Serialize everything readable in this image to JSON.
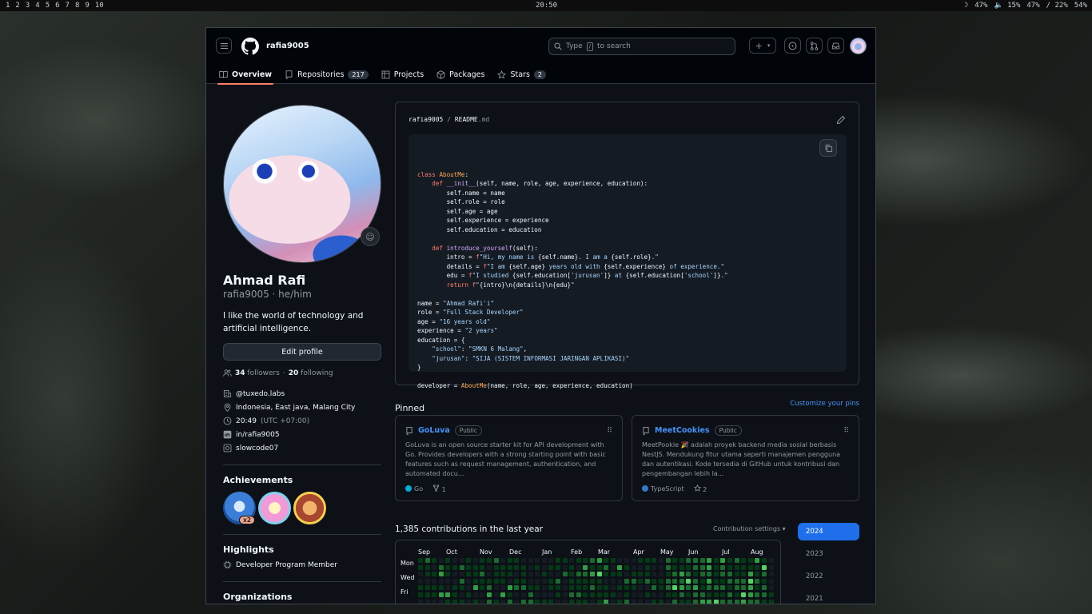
{
  "topbar": {
    "workspaces": [
      "1",
      "2",
      "3",
      "4",
      "5",
      "6",
      "7",
      "8",
      "9",
      "10"
    ],
    "clock": "20:50",
    "status": [
      "47%",
      "15%",
      "47%",
      "/ 22%",
      "54%"
    ]
  },
  "header": {
    "username": "rafia9005",
    "search_placeholder_prefix": "Type",
    "search_key": "/",
    "search_placeholder_suffix": "to search",
    "plus": "+"
  },
  "tabs": [
    {
      "label": "Overview",
      "count": ""
    },
    {
      "label": "Repositories",
      "count": "217"
    },
    {
      "label": "Projects",
      "count": ""
    },
    {
      "label": "Packages",
      "count": ""
    },
    {
      "label": "Stars",
      "count": "2"
    }
  ],
  "profile": {
    "name": "Ahmad Rafi",
    "login": "rafia9005 · he/him",
    "bio": "I like the world of technology and artificial intelligence.",
    "edit_label": "Edit profile",
    "followers": "34",
    "followers_label": "followers",
    "following": "20",
    "following_label": "following",
    "company": "@tuxedo.labs",
    "location": "Indonesia, East java, Malang City",
    "time": "20:49",
    "timezone": "(UTC +07:00)",
    "linkedin": "in/rafia9005",
    "social": "slowcode07"
  },
  "achievements": {
    "title": "Achievements",
    "badges": [
      "pull-shark-badge",
      "yolo-badge",
      "quickdraw-badge"
    ],
    "multiplier": "x2"
  },
  "highlights": {
    "title": "Highlights",
    "item": "Developer Program Member"
  },
  "organizations": {
    "title": "Organizations"
  },
  "readme": {
    "owner": "rafia9005",
    "sep": "/",
    "file": "README",
    "ext": ".md",
    "code": [
      [
        [
          "kw",
          "class "
        ],
        [
          "cls",
          "AboutMe"
        ],
        [
          "",
          ":"
        ]
      ],
      [
        [
          "",
          "    "
        ],
        [
          "kw",
          "def "
        ],
        [
          "fn",
          "__init__"
        ],
        [
          "",
          "(self, name, role, age, experience, education):"
        ]
      ],
      [
        [
          "",
          "        self.name = name"
        ]
      ],
      [
        [
          "",
          "        self.role = role"
        ]
      ],
      [
        [
          "",
          "        self.age = age"
        ]
      ],
      [
        [
          "",
          "        self.experience = experience"
        ]
      ],
      [
        [
          "",
          "        self.education = education"
        ]
      ],
      [
        [
          "",
          ""
        ]
      ],
      [
        [
          "",
          "    "
        ],
        [
          "kw",
          "def "
        ],
        [
          "fn",
          "introduce_yourself"
        ],
        [
          "",
          "(self):"
        ]
      ],
      [
        [
          "",
          "        intro = "
        ],
        [
          "kw",
          "f"
        ],
        [
          "str",
          "\"Hi, my name is "
        ],
        [
          "",
          "{self.name}"
        ],
        [
          "str",
          ". I am a "
        ],
        [
          "",
          "{self.role}"
        ],
        [
          "str",
          ".\""
        ]
      ],
      [
        [
          "",
          "        details = "
        ],
        [
          "kw",
          "f"
        ],
        [
          "str",
          "\"I am "
        ],
        [
          "",
          "{self.age}"
        ],
        [
          "str",
          " years old with "
        ],
        [
          "",
          "{self.experience}"
        ],
        [
          "str",
          " of experience.\""
        ]
      ],
      [
        [
          "",
          "        edu = "
        ],
        [
          "kw",
          "f"
        ],
        [
          "str",
          "\"I studied "
        ],
        [
          "",
          "{self.education["
        ],
        [
          "str",
          "'jurusan'"
        ],
        [
          "",
          "]}"
        ],
        [
          "str",
          " at "
        ],
        [
          "",
          "{self.education["
        ],
        [
          "str",
          "'school'"
        ],
        [
          "",
          "]}"
        ],
        [
          "str",
          ".\""
        ]
      ],
      [
        [
          "",
          "        "
        ],
        [
          "kw",
          "return "
        ],
        [
          "kw",
          "f"
        ],
        [
          "str",
          "\""
        ],
        [
          "",
          "{intro}\\n{details}\\n{edu}"
        ],
        [
          "str",
          "\""
        ]
      ],
      [
        [
          "",
          ""
        ]
      ],
      [
        [
          "",
          "name = "
        ],
        [
          "str",
          "\"Ahmad Rafi'i\""
        ]
      ],
      [
        [
          "",
          "role = "
        ],
        [
          "str",
          "\"Full Stack Developer\""
        ]
      ],
      [
        [
          "",
          "age = "
        ],
        [
          "str",
          "\"16 years old\""
        ]
      ],
      [
        [
          "",
          "experience = "
        ],
        [
          "str",
          "\"2 years\""
        ]
      ],
      [
        [
          "",
          "education = {"
        ]
      ],
      [
        [
          "",
          "    "
        ],
        [
          "str",
          "\"school\""
        ],
        [
          "",
          ": "
        ],
        [
          "str",
          "\"SMKN 6 Malang\""
        ],
        [
          "",
          ","
        ]
      ],
      [
        [
          "",
          "    "
        ],
        [
          "str",
          "\"jurusan\""
        ],
        [
          "",
          ": "
        ],
        [
          "str",
          "\"SIJA (SISTEM INFORMASI JARINGAN APLIKASI)\""
        ]
      ],
      [
        [
          "",
          "}"
        ]
      ],
      [
        [
          "",
          ""
        ]
      ],
      [
        [
          "",
          "developer = "
        ],
        [
          "cls",
          "AboutMe"
        ],
        [
          "",
          "(name, role, age, experience, education)"
        ]
      ]
    ]
  },
  "pinned": {
    "title": "Pinned",
    "customize": "Customize your pins",
    "repos": [
      {
        "name": "GoLuva",
        "visibility": "Public",
        "description": "GoLuva is an open source starter kit for API development with Go. Provides developers with a strong starting point with basic features such as request management, authentication, and automated docu...",
        "language": "Go",
        "language_color": "#00add8",
        "stat_icon": "fork-icon",
        "stat": "1"
      },
      {
        "name": "MeetCookies",
        "visibility": "Public",
        "description": "MeetPookie 🎉 adalah proyek backend media sosial berbasis NestJS. Mendukung fitur utama seperti manajemen pengguna dan autentikasi. Kode tersedia di GitHub untuk kontribusi dan pengembangan lebih la...",
        "language": "TypeScript",
        "language_color": "#3178c6",
        "stat_icon": "star-icon",
        "stat": "2"
      }
    ]
  },
  "contributions": {
    "title": "1,385 contributions in the last year",
    "settings": "Contribution settings ▾",
    "months": [
      "Sep",
      "Oct",
      "Nov",
      "Dec",
      "Jan",
      "Feb",
      "Mar",
      "Apr",
      "May",
      "Jun",
      "Jul",
      "Aug"
    ],
    "days": [
      "Mon",
      "Wed",
      "Fri"
    ],
    "years": [
      "2024",
      "2023",
      "2022",
      "2021"
    ],
    "colors": [
      "#151b23",
      "#033a16",
      "#196c2e",
      "#2ea043",
      "#56d364"
    ]
  }
}
